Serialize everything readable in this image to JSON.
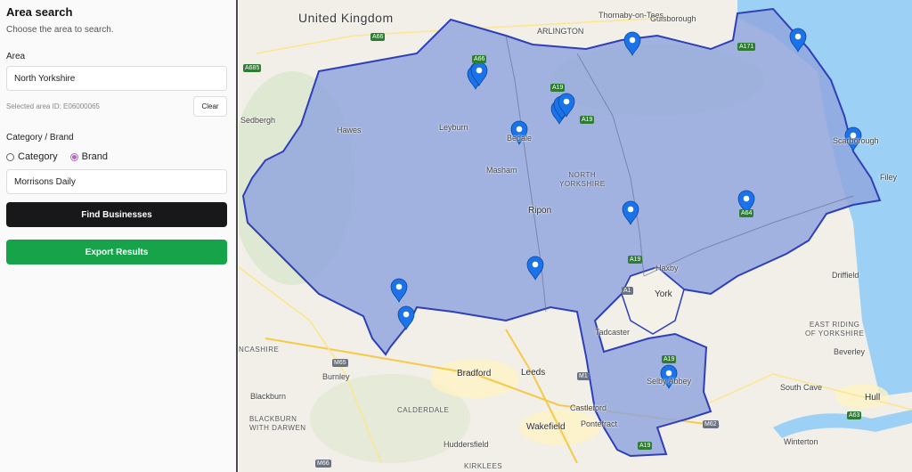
{
  "panel": {
    "title": "Area search",
    "subtitle": "Choose the area to search.",
    "area_label": "Area",
    "area_value": "North Yorkshire",
    "area_id_text": "Selected area ID: E06000065",
    "clear_label": "Clear",
    "category_label": "Category / Brand",
    "radio_category": "Category",
    "radio_brand": "Brand",
    "radio_selected": "Brand",
    "brand_value": "Morrisons Daily",
    "find_label": "Find Businesses",
    "export_label": "Export Results"
  },
  "colors": {
    "area_fill": "#8fa5de",
    "area_stroke": "#2f3fb8",
    "pin": "#1a73e8",
    "export": "#16a34a",
    "find": "#18181b",
    "sea": "#9cd0f5"
  },
  "map": {
    "country": "United Kingdom",
    "region": [
      "NORTH",
      "YORKSHIRE"
    ],
    "east_riding": [
      "EAST RIDING",
      "OF YORKSHIRE"
    ],
    "towns": {
      "darlington": "ARLINGTON",
      "thornaby": "Thornaby-on-Tees",
      "guisborough": "Guisborough",
      "sedbergh": "Sedbergh",
      "hawes": "Hawes",
      "leyburn": "Leyburn",
      "bedale": "Bedale",
      "masham": "Masham",
      "scarborough": "Scarborough",
      "filey": "Filey",
      "ripon": "Ripon",
      "haxby": "Haxby",
      "york": "York",
      "driffield": "Driffield",
      "tadcaster": "Tadcaster",
      "beverley": "Beverley",
      "selby": "Selby Abbey",
      "burnley": "Burnley",
      "bradford": "Bradford",
      "leeds": "Leeds",
      "blackburn": "Blackburn",
      "blackburn_darwen": "BLACKBURN\nWITH DARWEN",
      "calderdale": "CALDERDALE",
      "castleford": "Castleford",
      "pontefract": "Pontefract",
      "wakefield": "Wakefield",
      "huddersfield": "Huddersfield",
      "kirklees": "KIRKLEES",
      "south_cave": "South Cave",
      "hull": "Hull",
      "winterton": "Winterton",
      "lancashire": "NCASHIRE"
    },
    "roads": {
      "a66": "A66",
      "a66m": "A66",
      "a685": "A685",
      "a171": "A171",
      "a19a": "A19",
      "a19b": "A19",
      "a19c": "A19",
      "a19d": "A19",
      "a19e": "A19",
      "a64": "A64",
      "a1": "A1",
      "a63": "A63",
      "a65": "A65",
      "m65": "M65",
      "m1": "M1",
      "m62": "M62",
      "m66": "M66"
    },
    "pin_count": 16
  }
}
